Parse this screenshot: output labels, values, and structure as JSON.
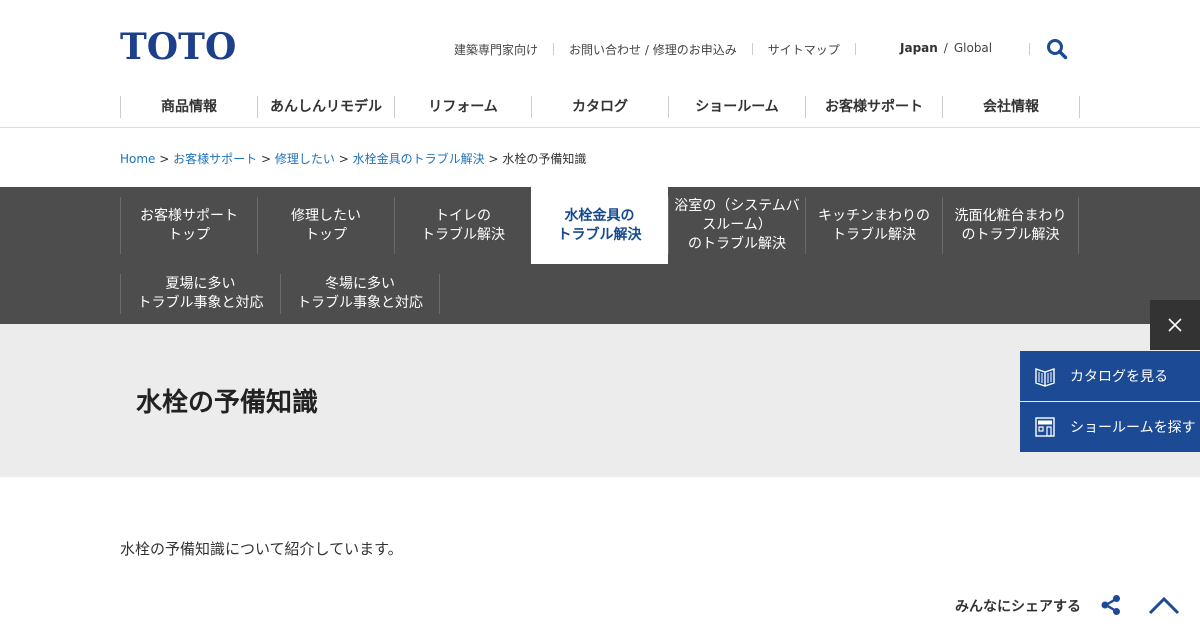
{
  "brand": {
    "logo_text": "TOTO",
    "color": "#1d3f8c"
  },
  "utility_links": [
    "建築専門家向け",
    "お問い合わせ / 修理のお申込み",
    "サイトマップ"
  ],
  "language": {
    "current": "Japan",
    "separator": "/",
    "other": "Global"
  },
  "global_nav": [
    "商品情報",
    "あんしんリモデル",
    "リフォーム",
    "カタログ",
    "ショールーム",
    "お客様サポート",
    "会社情報"
  ],
  "breadcrumb": {
    "links": [
      "Home",
      "お客様サポート",
      "修理したい",
      "水栓金具のトラブル解決"
    ],
    "separator": ">",
    "current": "水栓の予備知識"
  },
  "sub_nav": {
    "row1": [
      {
        "l1": "お客様サポート",
        "l2": "トップ",
        "l3": ""
      },
      {
        "l1": "修理したい",
        "l2": "トップ",
        "l3": ""
      },
      {
        "l1": "トイレの",
        "l2": "トラブル解決",
        "l3": ""
      },
      {
        "l1": "水栓金具の",
        "l2": "トラブル解決",
        "l3": "",
        "active": true
      },
      {
        "l1": "浴室の（システムバ",
        "l2": "スルーム）",
        "l3": "のトラブル解決"
      },
      {
        "l1": "キッチンまわりの",
        "l2": "トラブル解決",
        "l3": ""
      },
      {
        "l1": "洗面化粧台まわり",
        "l2": "のトラブル解決",
        "l3": ""
      }
    ],
    "row2": [
      {
        "l1": "夏場に多い",
        "l2": "トラブル事象と対応"
      },
      {
        "l1": "冬場に多い",
        "l2": "トラブル事象と対応"
      }
    ]
  },
  "page": {
    "title": "水栓の予備知識",
    "intro": "水栓の予備知識について紹介しています。"
  },
  "share": {
    "label": "みんなにシェアする"
  },
  "side_widget": {
    "catalog_label": "カタログを見る",
    "showroom_label": "ショールームを探す",
    "color": "#1d4a94"
  },
  "icons": [
    "search-icon",
    "close-icon",
    "catalog-book-icon",
    "showroom-building-icon",
    "share-icon",
    "chevron-up-icon"
  ]
}
